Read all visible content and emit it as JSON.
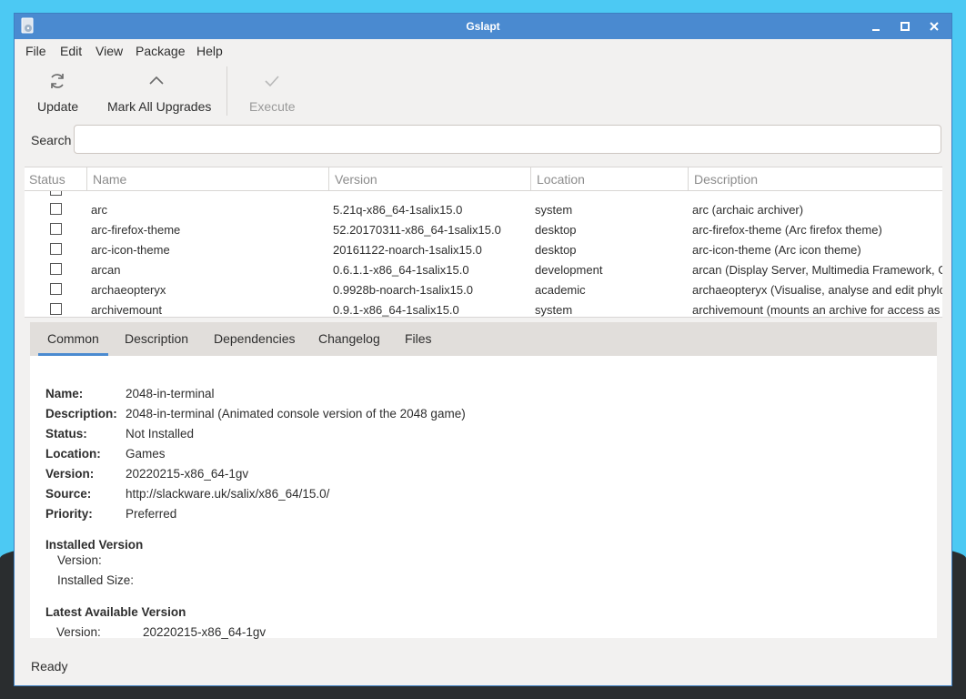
{
  "window": {
    "title": "Gslapt"
  },
  "menu": [
    "File",
    "Edit",
    "View",
    "Package",
    "Help"
  ],
  "toolbar": {
    "update": "Update",
    "mark_all": "Mark All Upgrades",
    "execute": "Execute"
  },
  "search": {
    "label": "Search",
    "value": "",
    "placeholder": ""
  },
  "table": {
    "columns": [
      "Status",
      "Name",
      "Version",
      "Location",
      "Description"
    ],
    "rows": [
      {
        "name": "arc",
        "version": "5.21q-x86_64-1salix15.0",
        "location": "system",
        "description": "arc (archaic archiver)"
      },
      {
        "name": "arc-firefox-theme",
        "version": "52.20170311-x86_64-1salix15.0",
        "location": "desktop",
        "description": "arc-firefox-theme (Arc firefox theme)"
      },
      {
        "name": "arc-icon-theme",
        "version": "20161122-noarch-1salix15.0",
        "location": "desktop",
        "description": "arc-icon-theme (Arc icon theme)"
      },
      {
        "name": "arcan",
        "version": "0.6.1.1-x86_64-1salix15.0",
        "location": "development",
        "description": "arcan (Display Server, Multimedia Framework, Game Engine)"
      },
      {
        "name": "archaeopteryx",
        "version": "0.9928b-noarch-1salix15.0",
        "location": "academic",
        "description": "archaeopteryx (Visualise, analyse and edit phylogenetic trees)"
      },
      {
        "name": "archivemount",
        "version": "0.9.1-x86_64-1salix15.0",
        "location": "system",
        "description": "archivemount (mounts an archive for access as a file system)"
      }
    ]
  },
  "tabs": [
    "Common",
    "Description",
    "Dependencies",
    "Changelog",
    "Files"
  ],
  "details": {
    "name_label": "Name:",
    "name": "2048-in-terminal",
    "description_label": "Description:",
    "description": "2048-in-terminal (Animated console version of the 2048 game)",
    "status_label": "Status:",
    "status": "Not Installed",
    "location_label": "Location:",
    "location": "Games",
    "version_label": "Version:",
    "version": "20220215-x86_64-1gv",
    "source_label": "Source:",
    "source": "http://slackware.uk/salix/x86_64/15.0/",
    "priority_label": "Priority:",
    "priority": "Preferred"
  },
  "installed": {
    "heading": "Installed Version",
    "version_label": "Version:",
    "version": "",
    "size_label": "Installed Size:",
    "size": ""
  },
  "latest": {
    "heading": "Latest Available Version",
    "version_label": "Version:",
    "version": "20220215-x86_64-1gv"
  },
  "status_bar": "Ready"
}
